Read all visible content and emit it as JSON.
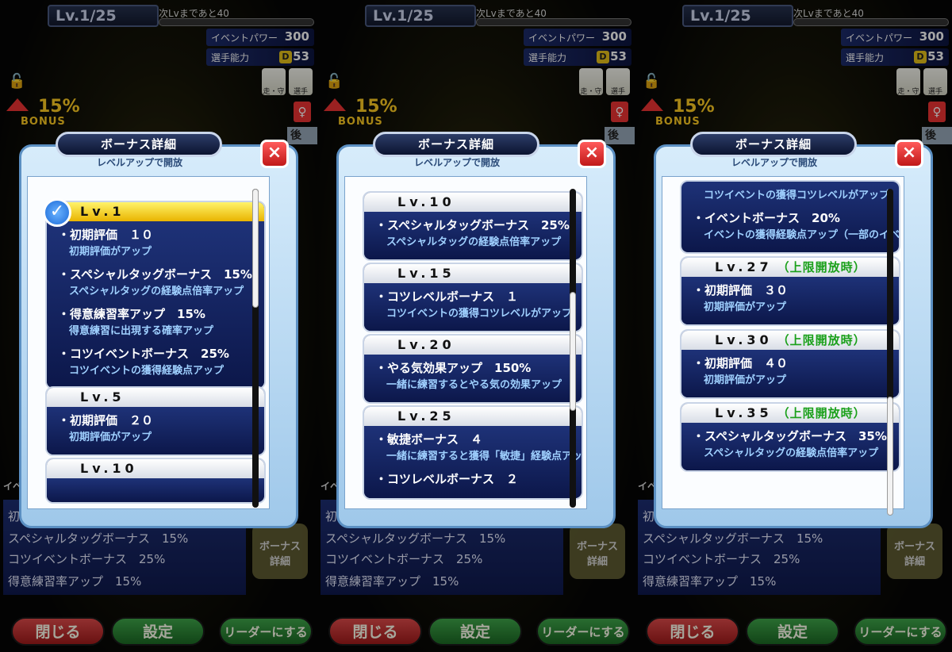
{
  "common": {
    "lv": "Lv.1/25",
    "next_lv": "次Lvまであと40",
    "event_power_label": "イベントパワー",
    "event_power_value": "300",
    "player_ability_label": "選手能力",
    "player_ability_rank": "D",
    "player_ability_value": "53",
    "skill_1_label": "走・守",
    "skill_2_label": "選手",
    "bonus_pct": "15%",
    "bonus_word": "BONUS",
    "gender_icon": "♀",
    "position": "後",
    "event_short": "イベ",
    "lower_list": [
      "初",
      "スペシャルタッグボーナス　15%",
      "コツイベントボーナス　25%",
      "得意練習率アップ　15%"
    ],
    "info_button": "ボーナス\n詳細",
    "close_button": "閉じる",
    "settings_button": "設定",
    "leader_button": "リーダーにする",
    "dialog_title": "ボーナス詳細",
    "dialog_subtitle": "レベルアップで開放",
    "close_icon": "×",
    "check_icon": "✓"
  },
  "panels": [
    {
      "cards": [
        {
          "level": "Lv.1",
          "active": true,
          "tag": "",
          "entries": [
            {
              "name": "・初期評価　１０",
              "desc": "初期評価がアップ"
            },
            {
              "name": "・スペシャルタッグボーナス　15%",
              "desc": "スペシャルタッグの経験点倍率アップ"
            },
            {
              "name": "・得意練習率アップ　15%",
              "desc": "得意練習に出現する確率アップ"
            },
            {
              "name": "・コツイベントボーナス　25%",
              "desc": "コツイベントの獲得経験点アップ"
            }
          ]
        },
        {
          "level": "Lv.5",
          "active": false,
          "tag": "",
          "entries": [
            {
              "name": "・初期評価　２０",
              "desc": "初期評価がアップ"
            }
          ]
        },
        {
          "level": "Lv.10",
          "active": false,
          "tag": "",
          "entries": []
        }
      ]
    },
    {
      "cards": [
        {
          "level": "Lv.10",
          "active": false,
          "tag": "",
          "entries": [
            {
              "name": "・スペシャルタッグボーナス　25%",
              "desc": "スペシャルタッグの経験点倍率アップ"
            }
          ]
        },
        {
          "level": "Lv.15",
          "active": false,
          "tag": "",
          "entries": [
            {
              "name": "・コツレベルボーナス　１",
              "desc": "コツイベントの獲得コツレベルがアップ"
            }
          ]
        },
        {
          "level": "Lv.20",
          "active": false,
          "tag": "",
          "entries": [
            {
              "name": "・やる気効果アップ　150%",
              "desc": "一緒に練習するとやる気の効果アップ"
            }
          ]
        },
        {
          "level": "Lv.25",
          "active": false,
          "tag": "",
          "entries": [
            {
              "name": "・敏捷ボーナス　４",
              "desc": "一緒に練習すると獲得「敏捷」経験点アップ"
            },
            {
              "name": "・コツレベルボーナス　２",
              "desc": ""
            }
          ]
        }
      ]
    },
    {
      "cards": [
        {
          "level": "",
          "active": false,
          "tag": "",
          "entries": [
            {
              "name": "",
              "desc": "コツイベントの獲得コツレベルがアップ"
            },
            {
              "name": "・イベントボーナス　20%",
              "desc": "イベントの獲得経験点アップ（一部のイベントを除く）"
            }
          ]
        },
        {
          "level": "Lv.27",
          "active": false,
          "tag": "（上限開放時）",
          "entries": [
            {
              "name": "・初期評価　３０",
              "desc": "初期評価がアップ"
            }
          ]
        },
        {
          "level": "Lv.30",
          "active": false,
          "tag": "（上限開放時）",
          "entries": [
            {
              "name": "・初期評価　４０",
              "desc": "初期評価がアップ"
            }
          ]
        },
        {
          "level": "Lv.35",
          "active": false,
          "tag": "（上限開放時）",
          "entries": [
            {
              "name": "・スペシャルタッグボーナス　35%",
              "desc": "スペシャルタッグの経験点倍率アップ"
            }
          ]
        }
      ]
    }
  ]
}
